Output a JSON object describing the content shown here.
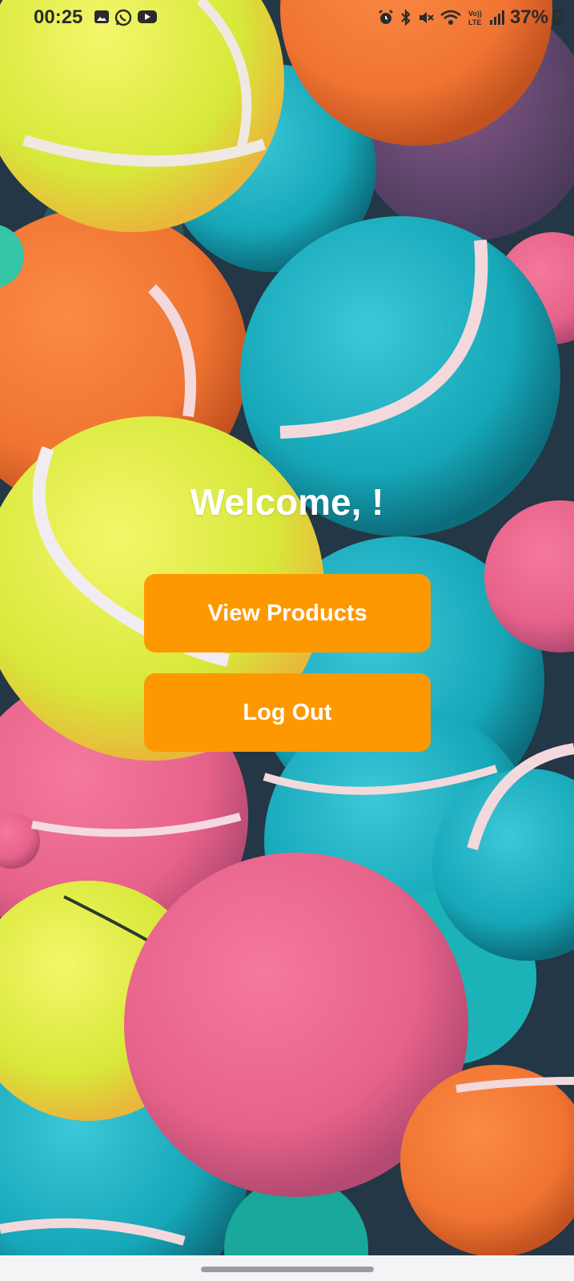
{
  "status_bar": {
    "time": "00:25",
    "battery": "37%",
    "left_icons": [
      "gallery-icon",
      "whatsapp-icon",
      "youtube-icon"
    ],
    "right_icons": [
      "alarm-icon",
      "bluetooth-icon",
      "mute-icon",
      "wifi-icon",
      "volte-icon",
      "signal-icon",
      "battery-icon"
    ]
  },
  "main": {
    "welcome_text": "Welcome, !",
    "view_products_label": "View Products",
    "logout_label": "Log Out"
  },
  "colors": {
    "button": "#fe9800",
    "button_text": "#ffffff",
    "welcome_text": "#ffffff"
  }
}
